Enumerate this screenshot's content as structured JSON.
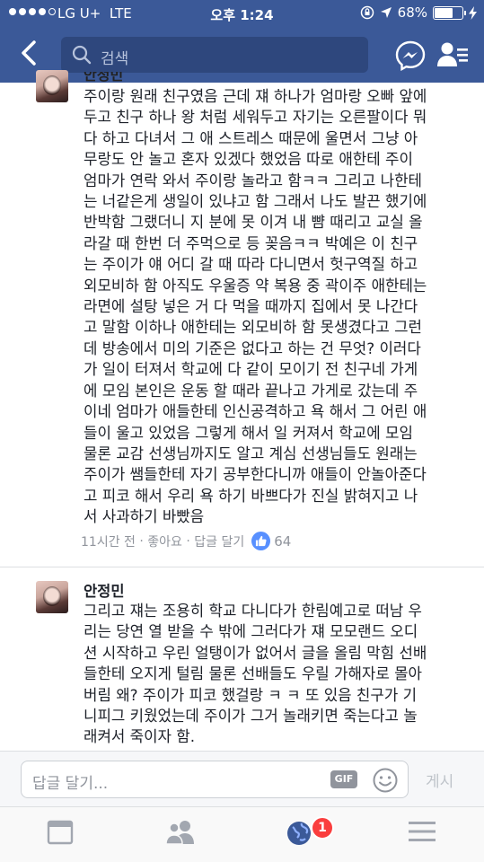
{
  "status_bar": {
    "carrier": "LG U+",
    "network": "LTE",
    "time": "오후 1:24",
    "battery": "68%",
    "battery_level": 0.68
  },
  "nav": {
    "search_placeholder": "검색",
    "icons": [
      "back-arrow-icon",
      "search-icon",
      "messenger-icon",
      "friend-requests-icon"
    ]
  },
  "comments": [
    {
      "author": "안정민",
      "lines": [
        "주이랑 원래 친구였음 근데 쟤 하나가 엄마랑 오빠 앞에",
        "두고 친구 하나 왕 처럼 세워두고 자기는 오른팔이다 뭐",
        "다  하고 다녀서 그 애 스트레스 때문에 울면서 그냥 아",
        "무랑도 안 놀고 혼자 있겠다 했었음 따로 애한테 주이",
        "엄마가 연락 와서 주이랑 놀라고 함ㅋㅋ 그리고 나한테",
        "는 너같은게 생일이 있냐고 함 그래서 나도 발끈 했기에",
        "반박함 그랬더니 지 분에 못 이겨 내 뺨 때리고 교실 올",
        "라갈 때 한번 더 주먹으로 등 꽂음ㅋㅋ 박예은 이 친구",
        "는 주이가 얘 어디 갈 때 따라 다니면서 헛구역질 하고",
        "외모비하 함 아직도 우울증 약 복용 중 곽이주 애한테는",
        "라면에 설탕 넣은 거 다 먹을 때까지 집에서 못 나간다",
        "고 말함 이하나 애한테는 외모비하 함 못생겼다고 그런",
        "데 방송에서 미의 기준은 없다고 하는 건 무엇? 이러다",
        "가 일이 터져서 학교에 다 같이 모이기 전 친구네 가게",
        "에 모임 본인은 운동 할 때라 끝나고 가게로 갔는데 주",
        "이네 엄마가 애들한테 인신공격하고 욕 해서 그 어린 애",
        "들이 울고 있었음 그렇게 해서 일 커져서 학교에 모임",
        "물론 교감 선생님까지도 알고 계심 선생님들도 원래는",
        "주이가 쌤들한테 자기 공부한다니까 애들이 안놀아준다",
        "고 피코 해서 우리 욕 하기 바쁘다가 진실 밝혀지고 나",
        "서 사과하기 바빴음"
      ],
      "time": "11시간 전",
      "like_label": "좋아요",
      "reply_label": "답글 달기",
      "like_count": "64"
    },
    {
      "author": "안정민",
      "lines": [
        "그리고 쟤는 조용히 학교 다니다가 한림예고로 떠남 우",
        "리는 당연 열 받을 수 밖에 그러다가 쟤 모모랜드 오디",
        "션 시작하고 우린 얼탱이가 없어서 글을 올림 막힘 선배",
        "들한테 오지게 털림 물론 선배들도 우릴 가해자로 몰아",
        "버림 왜? 주이가 피코 했걸랑 ㅋ ㅋ 또 있음 친구가 기",
        "니피그 키웠었는데 주이가 그거 놀래키면 죽는다고 놀",
        "래켜서 죽이자 함."
      ]
    }
  ],
  "reply_bar": {
    "placeholder": "답글 달기...",
    "gif_label": "GIF",
    "post_label": "게시"
  },
  "tab_bar": {
    "tabs": [
      "news-feed-icon",
      "friends-icon",
      "notifications-globe-icon",
      "menu-icon"
    ],
    "notification_count": "1"
  },
  "colors": {
    "brand": "#3b5998",
    "like": "#5890ff",
    "badge": "#fa3e3e"
  }
}
